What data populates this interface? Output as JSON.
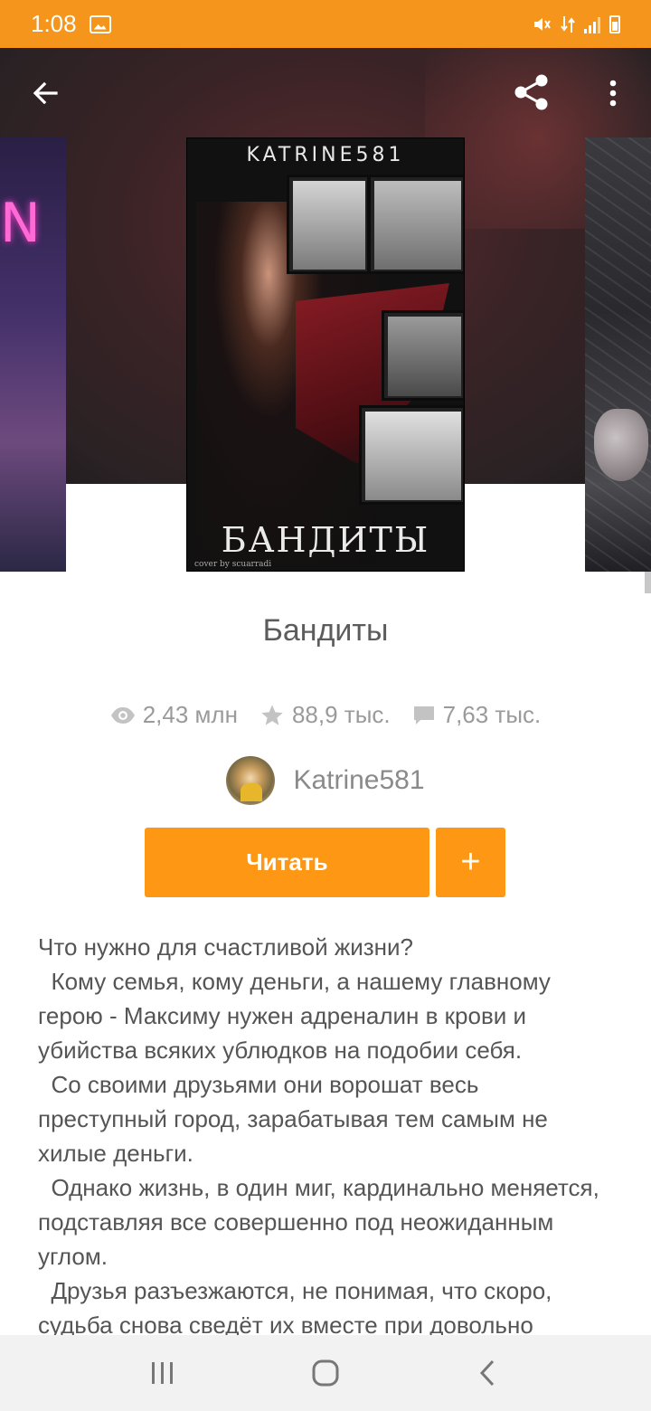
{
  "status_bar": {
    "time": "1:08"
  },
  "toolbar": {
    "back_icon": "arrow-left-icon",
    "share_icon": "share-icon",
    "menu_icon": "more-vertical-icon"
  },
  "cover": {
    "author_text": "KATRINE581",
    "title_text": "БАНДИТЫ",
    "credit_text": "cover by scuarradi"
  },
  "story": {
    "title": "Бандиты",
    "views": "2,43 млн",
    "votes": "88,9 тыс.",
    "comments": "7,63 тыс.",
    "author": "Katrine581"
  },
  "actions": {
    "read_label": "Читать",
    "add_label": "+"
  },
  "description": [
    "Что нужно для счастливой жизни?",
    "  Кому семья, кому деньги, а нашему главному герою - Максиму нужен адреналин в крови и убийства всяких ублюдков на подобии себя.",
    "  Со своими друзьями они ворошат весь преступный город, зарабатывая тем самым не хилые деньги.",
    "  Однако жизнь, в один миг, кардинально меняется, подставляя все совершенно под неожиданным углом.",
    "  Друзья разъезжаются, не понимая, что скоро, судьба снова сведёт их вместе при довольно"
  ],
  "colors": {
    "accent": "#fe9714",
    "status_bar": "#f5951b"
  }
}
